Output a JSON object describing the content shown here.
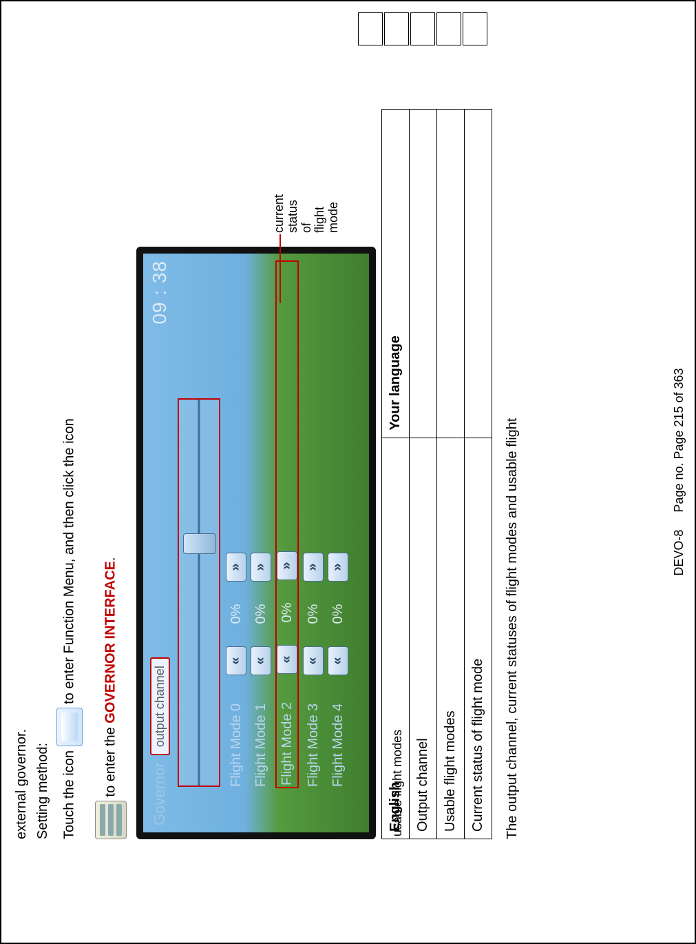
{
  "doc": {
    "line1": "external governor.",
    "line2": "Setting method:",
    "touch_pre": "Touch the icon",
    "touch_post": "to enter Function Menu, and then click the icon",
    "enter_pre": "to enter the ",
    "enter_red": "GOVERNOR INTERFACE",
    "enter_post": ".",
    "bottom": "The output channel, current statuses of flight modes and usable flight"
  },
  "screenshot": {
    "title": "Governor",
    "output_label": "output channel",
    "clock": "09 : 38",
    "flight_modes": [
      {
        "label": "Flight Mode 0",
        "value": "0%"
      },
      {
        "label": "Flight Mode 1",
        "value": "0%"
      },
      {
        "label": "Flight Mode 2",
        "value": "0%"
      },
      {
        "label": "Flight Mode 3",
        "value": "0%"
      },
      {
        "label": "Flight Mode 4",
        "value": "0%"
      }
    ],
    "arrow_btn_left": "«",
    "arrow_btn_right": "»",
    "current_label_line1": "current status",
    "current_label_line2": "of flight mode",
    "usable_label": "usable flight modes",
    "current_index": 2
  },
  "table": {
    "head_en": "English",
    "head_lang": "Your language",
    "rows": [
      "Output channel",
      "Usable flight modes",
      "Current status of flight mode"
    ]
  },
  "footer": {
    "left": "DEVO-8",
    "right": "Page no. Page 215 of 363"
  }
}
